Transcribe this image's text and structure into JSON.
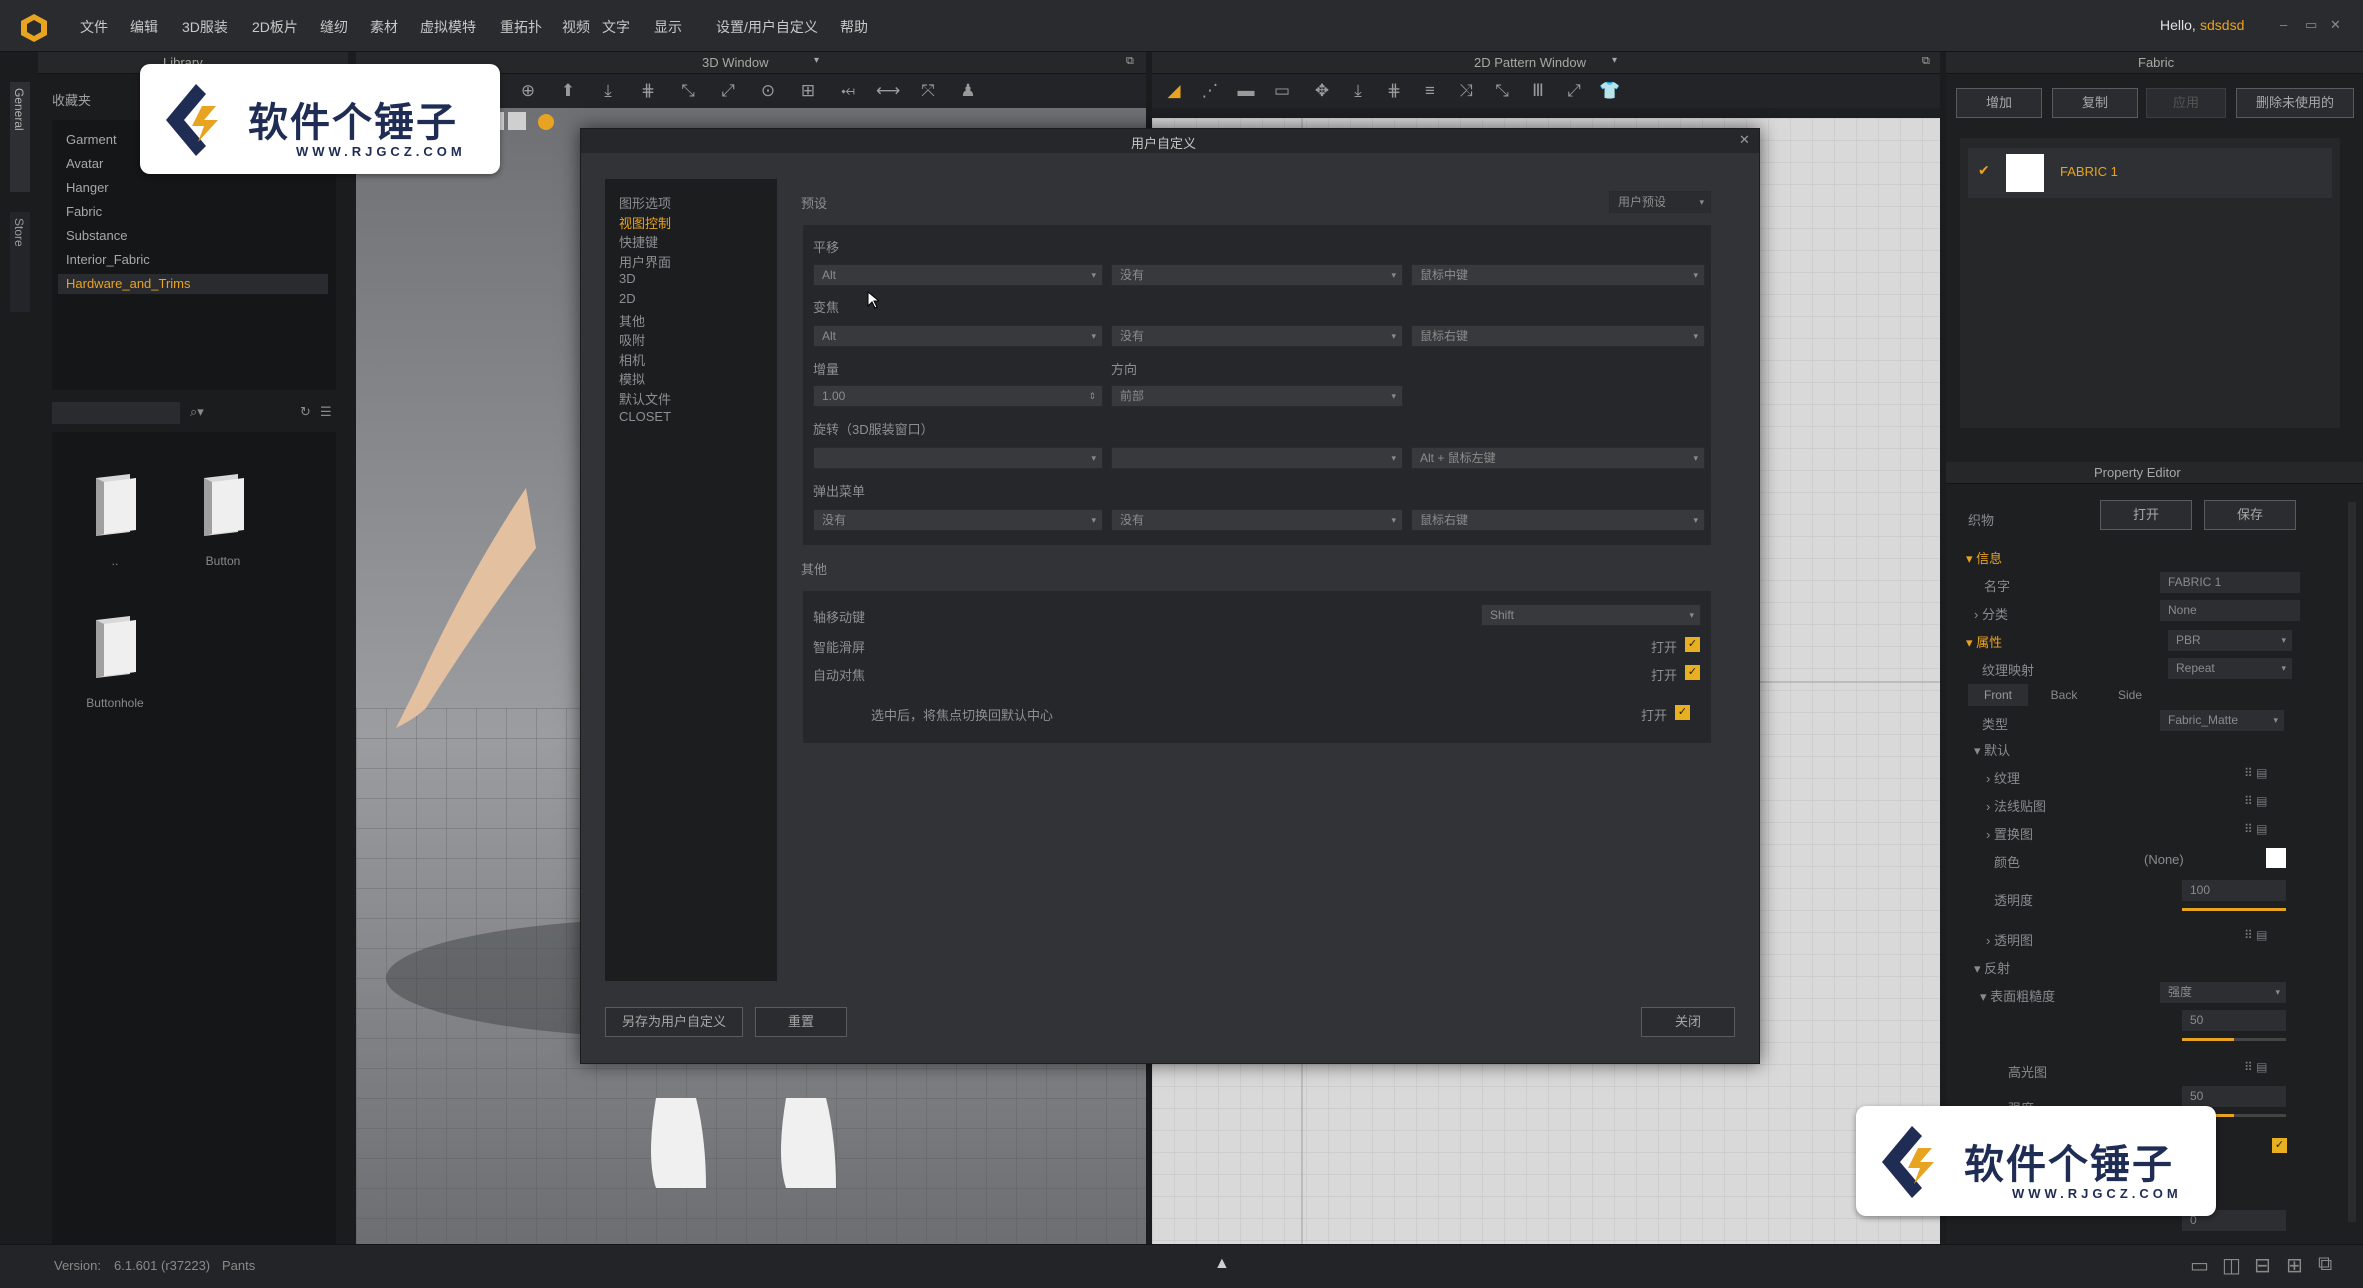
{
  "menubar": {
    "items": [
      "文件",
      "编辑",
      "3D服装",
      "2D板片",
      "缝纫",
      "素材",
      "虚拟模特",
      "重拓扑",
      "视频",
      "文字",
      "显示",
      "设置/用户自定义",
      "帮助"
    ],
    "greeting": "Hello,",
    "username": "sdsdsd",
    "window_controls": [
      "–",
      "▭",
      "✕"
    ]
  },
  "left_tabs": [
    "General",
    "Store"
  ],
  "library": {
    "title": "Library",
    "folder_label": "收藏夹",
    "tree": [
      "Garment",
      "Avatar",
      "Hanger",
      "Fabric",
      "Substance",
      "Interior_Fabric",
      "Hardware_and_Trims"
    ],
    "selected": "Hardware_and_Trims",
    "items": [
      {
        "label": "..",
        "icon": "folder-icon"
      },
      {
        "label": "Button",
        "icon": "folder-icon"
      },
      {
        "label": "Buttonhole",
        "icon": "folder-icon"
      }
    ]
  },
  "viewport3d": {
    "title": "3D Window"
  },
  "pattern2d": {
    "title": "2D Pattern Window"
  },
  "fabric_panel": {
    "title": "Fabric",
    "buttons": [
      "增加",
      "复制",
      "应用",
      "删除未使用的"
    ],
    "items": [
      {
        "name": "FABRIC 1"
      }
    ]
  },
  "property_editor": {
    "title": "Property Editor",
    "header_label": "织物",
    "open_label": "打开",
    "save_label": "保存",
    "section_info": "信息",
    "name_label": "名字",
    "name_value": "FABRIC 1",
    "category_label": "分类",
    "category_value": "None",
    "section_props": "属性",
    "prop_value": "PBR",
    "texture_map_label": "纹理映射",
    "texture_map_value": "Repeat",
    "side_tabs": [
      "Front",
      "Back",
      "Side"
    ],
    "type_label": "类型",
    "type_value": "Fabric_Matte",
    "default_label": "默认",
    "texture_label": "纹理",
    "normal_label": "法线贴图",
    "displacement_label": "置换图",
    "color_label": "颜色",
    "color_value": "(None)",
    "opacity_label": "透明度",
    "opacity_value": "100",
    "opacity_level": 1.0,
    "opacity_map_label": "透明图",
    "reflection_label": "反射",
    "roughness_label": "表面粗糙度",
    "roughness_mode": "强度",
    "roughness_value": "50",
    "roughness_level": 0.5,
    "gloss_map_label": "高光图",
    "gloss_value": "50",
    "gloss_level": 0.5,
    "gloss_label": "强度",
    "metal_value": "0"
  },
  "dialog": {
    "title": "用户自定义",
    "categories": [
      "图形选项",
      "视图控制",
      "快捷键",
      "用户界面",
      "3D",
      "2D",
      "其他",
      "吸附",
      "相机",
      "模拟",
      "默认文件",
      "CLOSET"
    ],
    "active_category": "视图控制",
    "preset_label": "预设",
    "preset_value": "用户预设",
    "pan_label": "平移",
    "pan": [
      "Alt",
      "没有",
      "鼠标中键"
    ],
    "zoom_label": "变焦",
    "zoom": [
      "Alt",
      "没有",
      "鼠标右键"
    ],
    "increment_label": "增量",
    "increment_value": "1.00",
    "direction_label": "方向",
    "direction_value": "前部",
    "rotate_label": "旋转（3D服装窗口）",
    "rotate": [
      "",
      "",
      "Alt + 鼠标左键"
    ],
    "popup_label": "弹出菜单",
    "popup": [
      "没有",
      "没有",
      "鼠标右键"
    ],
    "other_label": "其他",
    "axis_move_label": "轴移动键",
    "axis_move_value": "Shift",
    "smooth_scroll_label": "智能滑屏",
    "smooth_scroll_value": "打开",
    "auto_focus_label": "自动对焦",
    "auto_focus_value": "打开",
    "focus_reset_label": "选中后，将焦点切换回默认中心",
    "focus_reset_value": "打开",
    "save_as_label": "另存为用户自定义",
    "reset_label": "重置",
    "close_label": "关闭"
  },
  "statusbar": {
    "version_label": "Version:",
    "version_value": "6.1.601 (r37223)",
    "mode": "Pants"
  },
  "watermark": {
    "title": "软件个锤子",
    "url": "WWW.RJGCZ.COM"
  },
  "colors": {
    "accent": "#e8a321",
    "dialog_bg": "#323336",
    "panel_bg": "#1e1f21"
  }
}
